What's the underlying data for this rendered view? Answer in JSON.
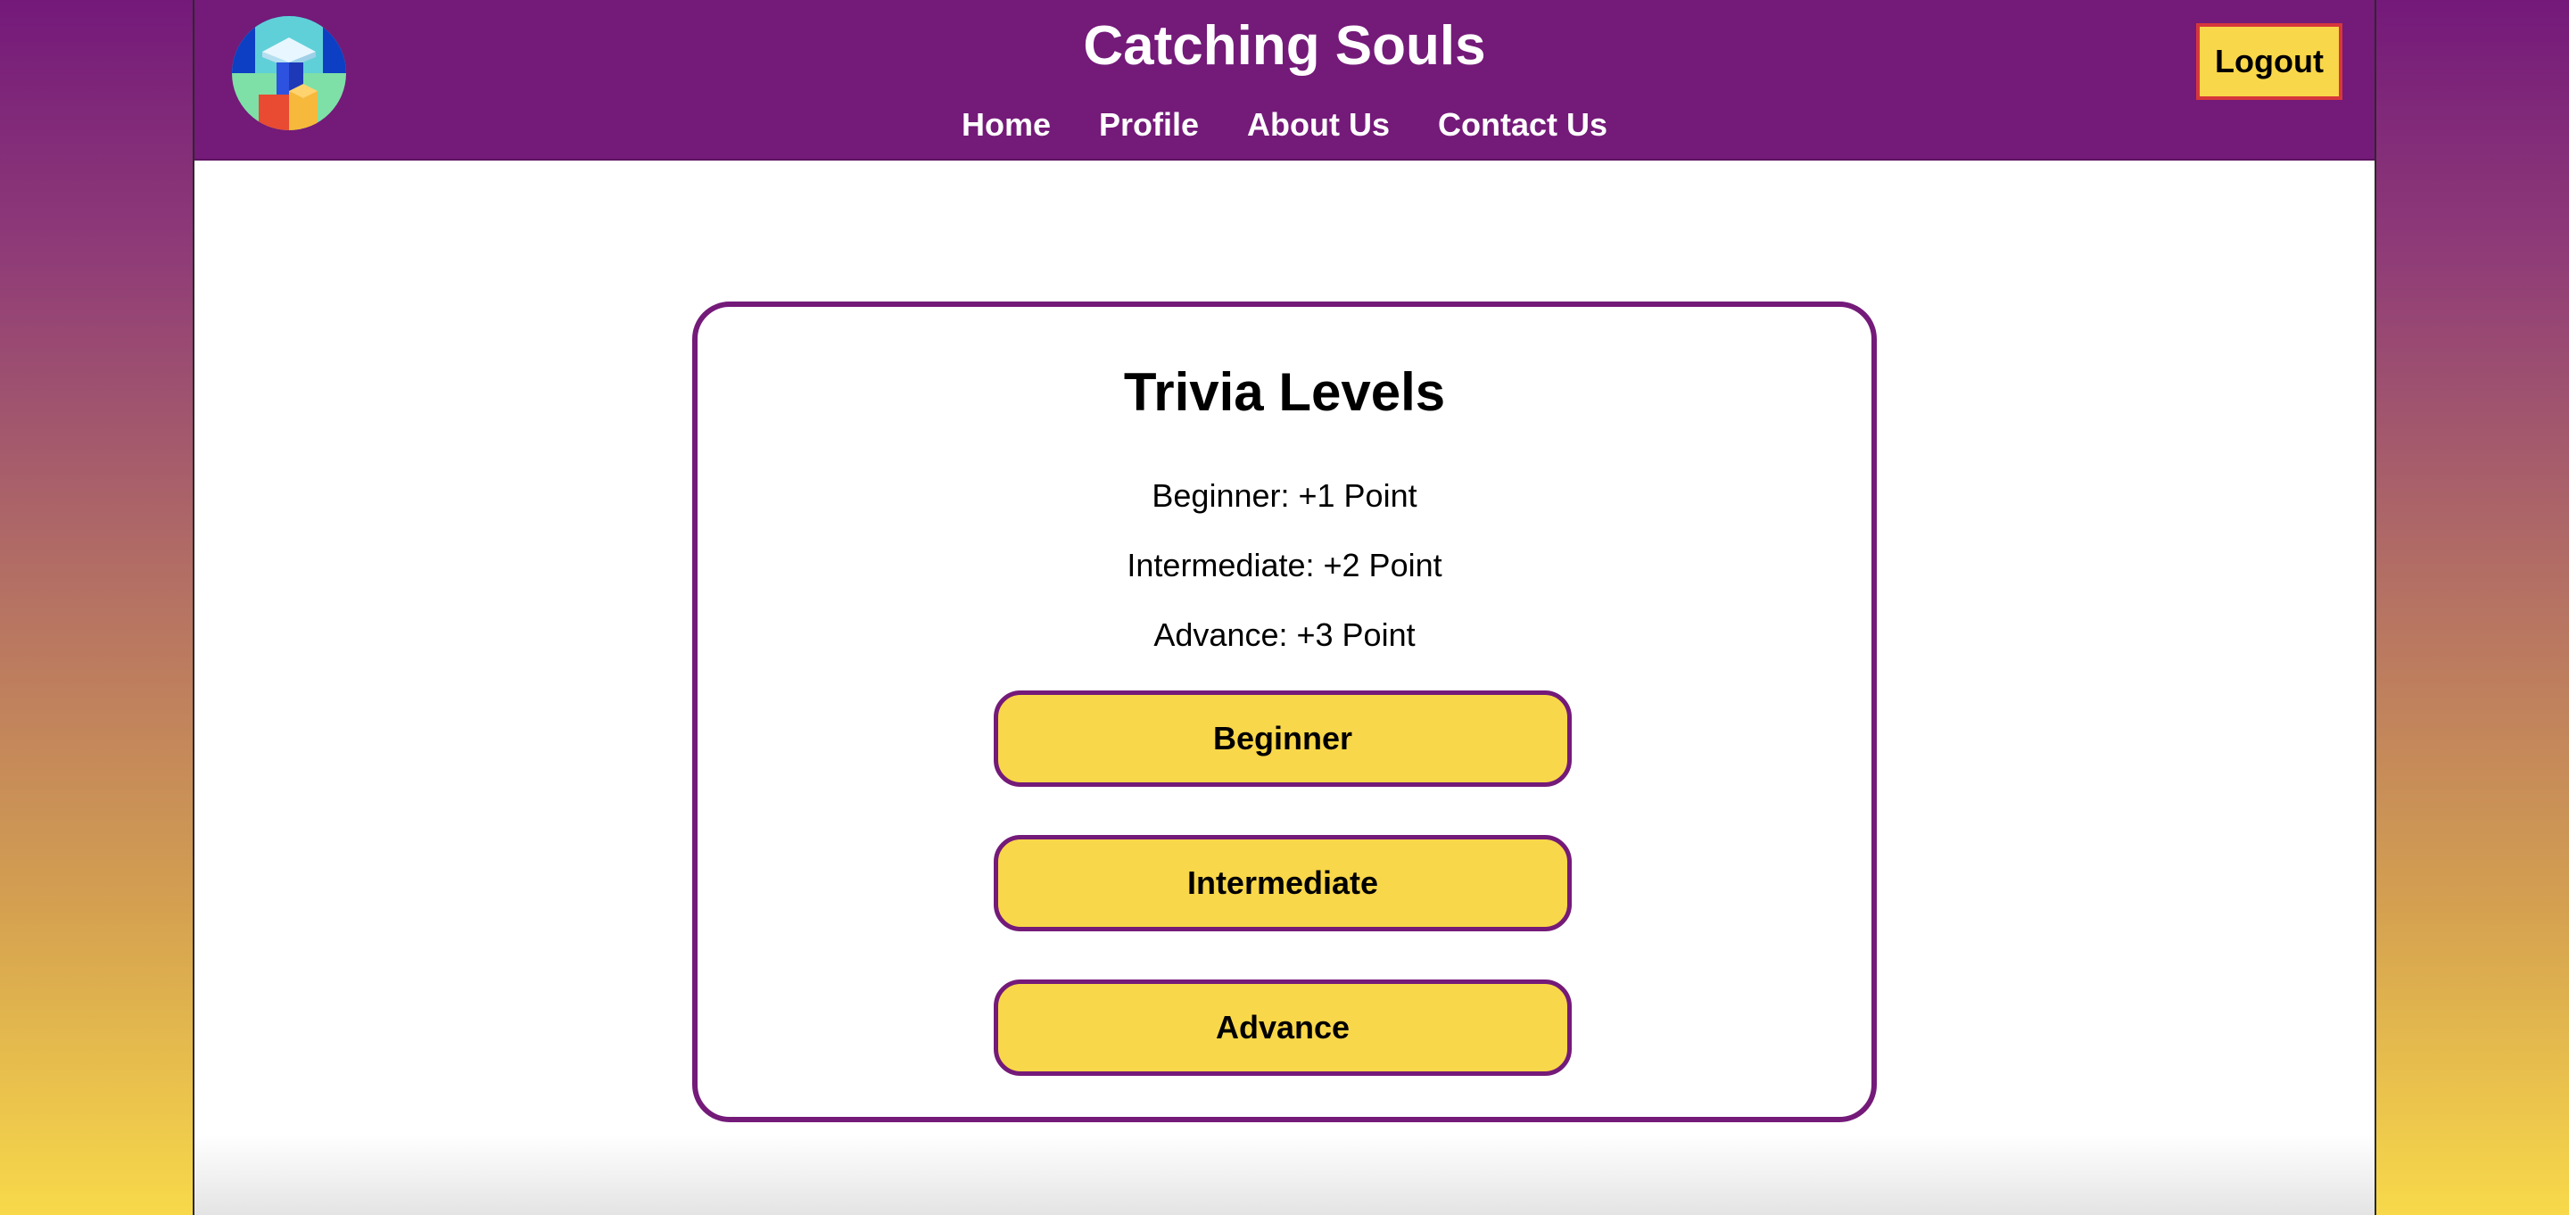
{
  "header": {
    "title": "Catching Souls",
    "logo_icon": "book-blocks-logo-icon",
    "nav": [
      {
        "label": "Home"
      },
      {
        "label": "Profile"
      },
      {
        "label": "About Us"
      },
      {
        "label": "Contact Us"
      }
    ],
    "logout_label": "Logout"
  },
  "trivia": {
    "title": "Trivia Levels",
    "points": [
      "Beginner: +1 Point",
      "Intermediate: +2 Point",
      "Advance: +3 Point"
    ],
    "levels": [
      {
        "label": "Beginner"
      },
      {
        "label": "Intermediate"
      },
      {
        "label": "Advance"
      }
    ]
  },
  "colors": {
    "brand_purple": "#741a79",
    "button_yellow": "#f9d74a",
    "logout_border_red": "#d6373b",
    "background_gradient_top": "#74197a",
    "background_gradient_bottom": "#f8d94a"
  }
}
